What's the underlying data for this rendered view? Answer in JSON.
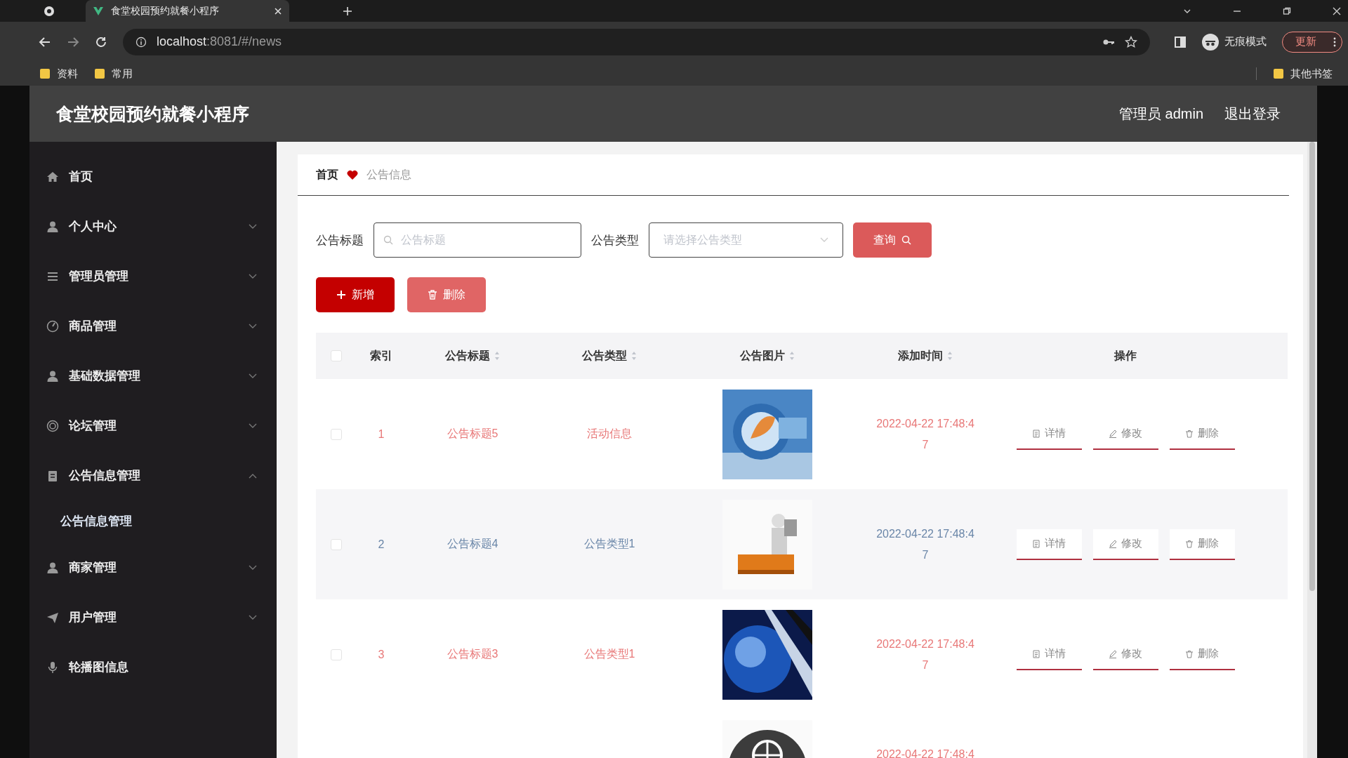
{
  "browser": {
    "tab_title": "食堂校园预约就餐小程序",
    "url_host": "localhost",
    "url_rest": ":8081/#/news",
    "incognito": "无痕模式",
    "update": "更新",
    "bookmarks": [
      "资料",
      "常用"
    ],
    "other_bookmarks": "其他书签"
  },
  "app": {
    "title": "食堂校园预约就餐小程序",
    "user": "管理员 admin",
    "logout": "退出登录"
  },
  "sidebar": {
    "items": [
      {
        "label": "首页",
        "kind": "link"
      },
      {
        "label": "个人中心",
        "kind": "menu",
        "expanded": false
      },
      {
        "label": "管理员管理",
        "kind": "menu",
        "expanded": false
      },
      {
        "label": "商品管理",
        "kind": "menu",
        "expanded": false
      },
      {
        "label": "基础数据管理",
        "kind": "menu",
        "expanded": false
      },
      {
        "label": "论坛管理",
        "kind": "menu",
        "expanded": false
      },
      {
        "label": "公告信息管理",
        "kind": "menu",
        "expanded": true,
        "children": [
          {
            "label": "公告信息管理",
            "selected": true
          }
        ]
      },
      {
        "label": "商家管理",
        "kind": "menu",
        "expanded": false
      },
      {
        "label": "用户管理",
        "kind": "menu",
        "expanded": false
      },
      {
        "label": "轮播图信息",
        "kind": "link"
      }
    ]
  },
  "breadcrumb": {
    "home": "首页",
    "current": "公告信息"
  },
  "search": {
    "title_label": "公告标题",
    "title_placeholder": "公告标题",
    "type_label": "公告类型",
    "type_placeholder": "请选择公告类型",
    "query": "查询"
  },
  "actions": {
    "add": "新增",
    "delete": "删除"
  },
  "table": {
    "columns": [
      {
        "label": "索引",
        "sortable": false
      },
      {
        "label": "公告标题",
        "sortable": true
      },
      {
        "label": "公告类型",
        "sortable": true
      },
      {
        "label": "公告图片",
        "sortable": true
      },
      {
        "label": "添加时间",
        "sortable": true
      },
      {
        "label": "操作",
        "sortable": false
      }
    ],
    "rows": [
      {
        "checked": false,
        "highlighted": false,
        "index": "1",
        "title": "公告标题5",
        "type": "活动信息",
        "time": "2022-04-22 17:48:47",
        "actions": [
          "详情",
          "修改",
          "删除"
        ]
      },
      {
        "checked": false,
        "highlighted": true,
        "index": "2",
        "title": "公告标题4",
        "type": "公告类型1",
        "time": "2022-04-22 17:48:47",
        "actions": [
          "详情",
          "修改",
          "删除"
        ]
      },
      {
        "checked": false,
        "highlighted": false,
        "index": "3",
        "title": "公告标题3",
        "type": "公告类型1",
        "time": "2022-04-22 17:48:47",
        "actions": [
          "详情",
          "修改",
          "删除"
        ]
      },
      {
        "time": "2022-04-22 17:48:4"
      }
    ],
    "select_all_checked": false
  }
}
